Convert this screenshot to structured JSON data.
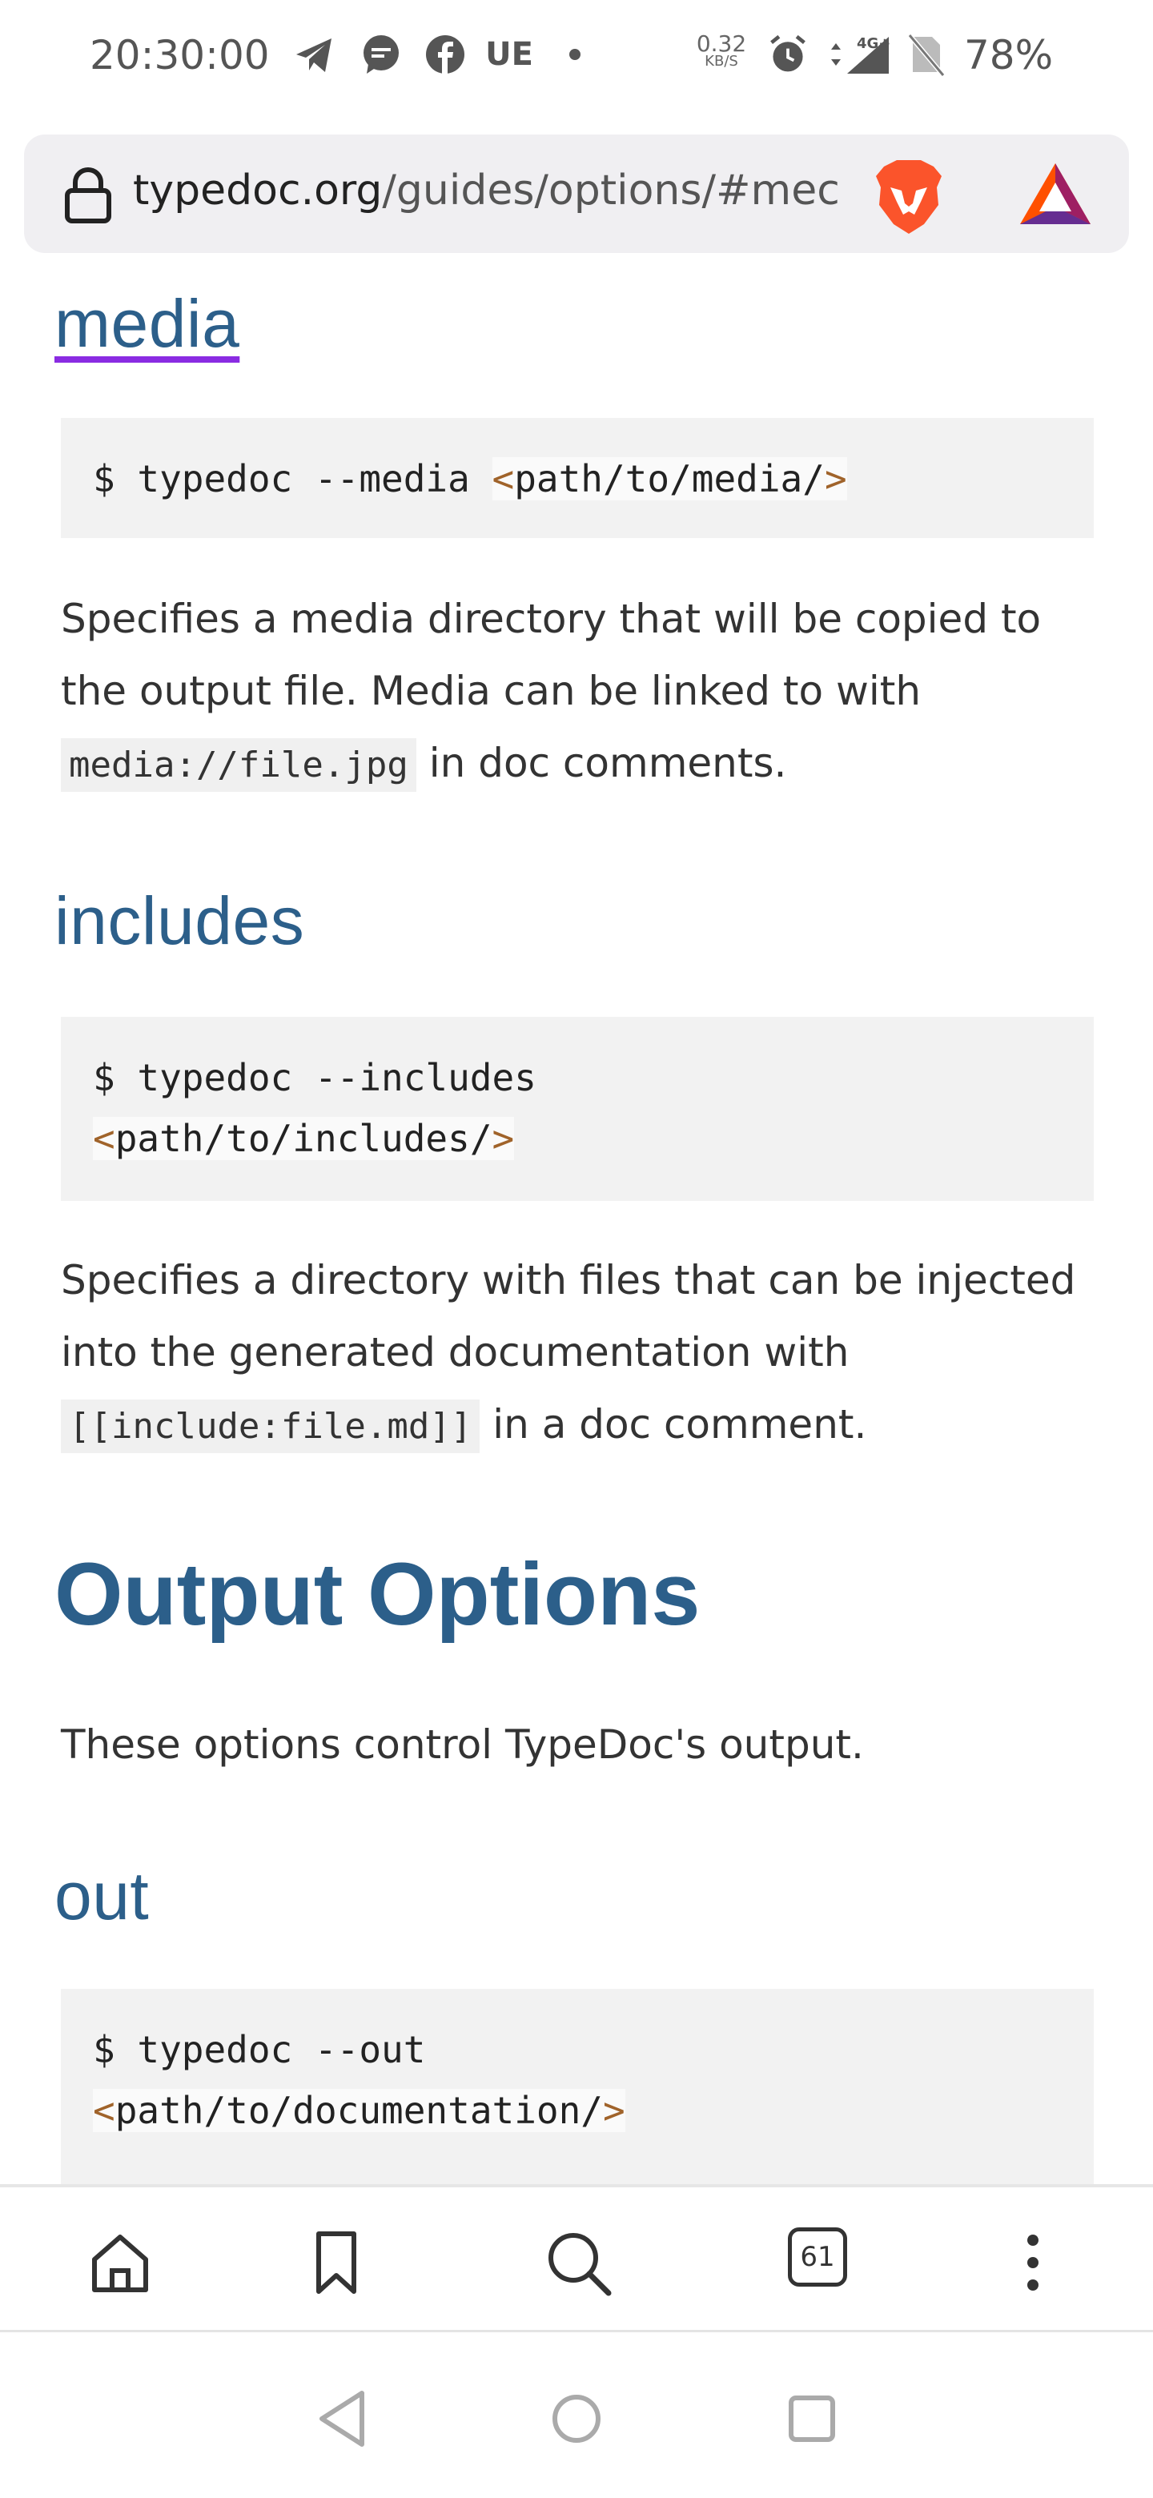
{
  "status_bar": {
    "time": "20:30:00",
    "carrier_badge": "UE",
    "net_speed_value": "0.32",
    "net_speed_unit": "KB/S",
    "signal_label": "4G+",
    "battery": "78%"
  },
  "browser": {
    "url_host": "typedoc.org",
    "url_path": "/guides/options/#mec",
    "tab_count": "61"
  },
  "content": {
    "media": {
      "heading": "media",
      "code_cmd": "$ typedoc --media ",
      "code_arg_open": "<",
      "code_arg": "path/to/media/",
      "code_arg_close": ">",
      "desc_before": "Specifies a media directory that will be copied to the output file. Media can be linked to with ",
      "desc_code": "media://file.jpg",
      "desc_after": " in doc comments."
    },
    "includes": {
      "heading": "includes",
      "code_cmd": "$ typedoc --includes",
      "code_arg_open": "<",
      "code_arg": "path/to/includes/",
      "code_arg_close": ">",
      "desc_before": "Specifies a directory with files that can be injected into the generated documentation with ",
      "desc_code": "[[include:file.md]]",
      "desc_after": " in a doc comment."
    },
    "output_options": {
      "heading": "Output Options",
      "desc": "These options control TypeDoc's output."
    },
    "out": {
      "heading": "out",
      "code_cmd": "$ typedoc --out",
      "code_arg_open": "<",
      "code_arg": "path/to/documentation/",
      "code_arg_close": ">"
    }
  },
  "colors": {
    "heading": "#2c5f8a",
    "link_underline": "#8a2be2",
    "code_bg": "#f2f2f2",
    "angle_bracket": "#a0632a"
  },
  "icons": [
    "telegram-icon",
    "chat-bubble-icon",
    "facebook-icon",
    "dot-icon",
    "alarm-icon",
    "signal-icon",
    "no-sim-icon",
    "lock-icon",
    "brave-lion-icon",
    "bat-triangle-icon",
    "home-icon",
    "bookmark-icon",
    "search-icon",
    "tabs-icon",
    "more-icon",
    "back-icon",
    "home-circle-icon",
    "recents-icon"
  ]
}
